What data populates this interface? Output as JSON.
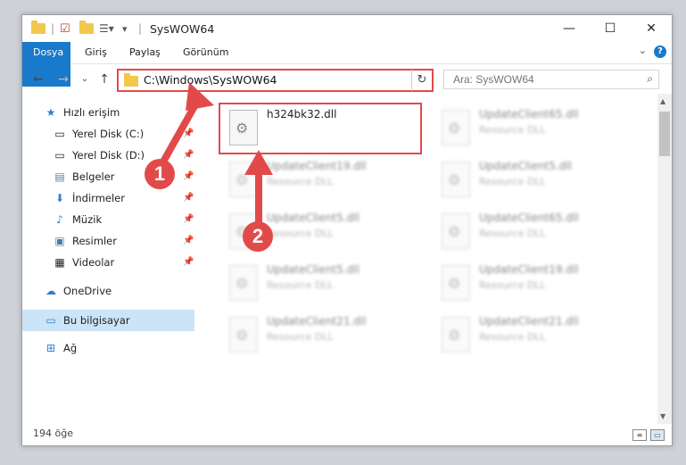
{
  "window": {
    "title": "SysWOW64"
  },
  "ribbon": {
    "tabs": [
      "Dosya",
      "Giriş",
      "Paylaş",
      "Görünüm"
    ],
    "help": "?"
  },
  "nav": {
    "address": "C:\\Windows\\SysWOW64",
    "search_placeholder": "Ara: SysWOW64"
  },
  "sidebar": {
    "items": [
      {
        "label": "Hızlı erişim",
        "icon": "star-icon",
        "pinned": false
      },
      {
        "label": "Yerel Disk (C:)",
        "icon": "drive-icon",
        "pinned": true
      },
      {
        "label": "Yerel Disk (D:)",
        "icon": "drive-icon",
        "pinned": true
      },
      {
        "label": "Belgeler",
        "icon": "documents-icon",
        "pinned": true
      },
      {
        "label": "İndirmeler",
        "icon": "download-icon",
        "pinned": true
      },
      {
        "label": "Müzik",
        "icon": "music-icon",
        "pinned": true
      },
      {
        "label": "Resimler",
        "icon": "pictures-icon",
        "pinned": true
      },
      {
        "label": "Videolar",
        "icon": "video-icon",
        "pinned": true
      },
      {
        "label": "OneDrive",
        "icon": "cloud-icon",
        "pinned": false
      },
      {
        "label": "Bu bilgisayar",
        "icon": "computer-icon",
        "pinned": false
      },
      {
        "label": "Ağ",
        "icon": "network-icon",
        "pinned": false
      }
    ]
  },
  "files": [
    {
      "name": "h324bk32.dll",
      "desc": ""
    },
    {
      "name": "UpdateClient65.dll",
      "desc": "Resource DLL"
    },
    {
      "name": "UpdateClient19.dll",
      "desc": "Resource DLL"
    },
    {
      "name": "UpdateClient5.dll",
      "desc": "Resource DLL"
    },
    {
      "name": "UpdateClient5.dll",
      "desc": "Resource DLL"
    },
    {
      "name": "UpdateClient65.dll",
      "desc": "Resource DLL"
    },
    {
      "name": "UpdateClient5.dll",
      "desc": "Resource DLL"
    },
    {
      "name": "UpdateClient19.dll",
      "desc": "Resource DLL"
    },
    {
      "name": "UpdateClient21.dll",
      "desc": "Resource DLL"
    },
    {
      "name": "UpdateClient21.dll",
      "desc": "Resource DLL"
    }
  ],
  "status": {
    "count": "194 öğe"
  },
  "annotations": {
    "badge1": "1",
    "badge2": "2",
    "color": "#e24a4a"
  }
}
